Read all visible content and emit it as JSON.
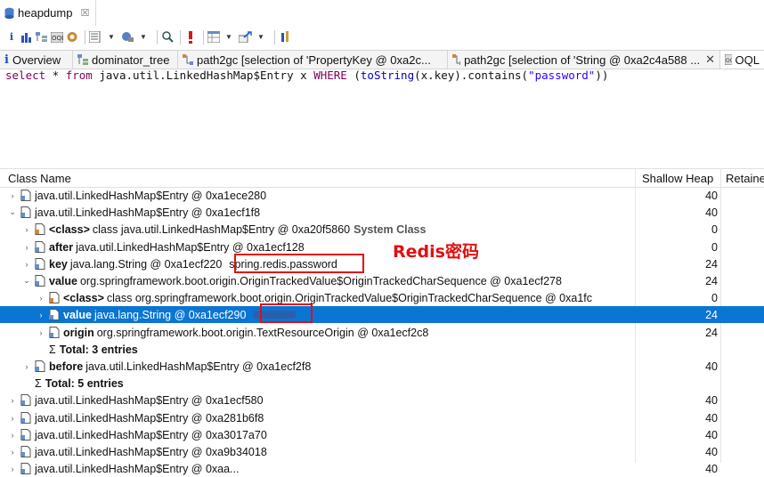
{
  "editor_tab": {
    "label": "heapdump",
    "close": "☒"
  },
  "toolbar": {
    "items": [
      "info-icon",
      "bar-chart-icon",
      "dominator-icon",
      "query-browser-icon",
      "heap-icon",
      "run-report-icon",
      "leak-icon",
      "search-icon",
      "warning-icon",
      "table-icon",
      "export-icon",
      "pin-icon"
    ]
  },
  "view_tabs": [
    {
      "icon": "i",
      "label": "Overview"
    },
    {
      "icon": "tree",
      "label": "dominator_tree"
    },
    {
      "icon": "path",
      "label": "path2gc  [selection of 'PropertyKey @ 0xa2c..."
    },
    {
      "icon": "path",
      "label": "path2gc  [selection of 'String @ 0xa2c4a588 ..."
    },
    {
      "icon": "oql",
      "label": "OQL"
    }
  ],
  "query": {
    "p1": "select",
    "p2": " * ",
    "p3": "from",
    "p4": " java.util.LinkedHashMap$Entry x ",
    "p5": "WHERE",
    "p6": " (",
    "p7": "toString",
    "p8": "(x.key).contains(",
    "p9": "\"password\"",
    "p10": "))"
  },
  "columns": {
    "name": "Class Name",
    "shallow": "Shallow Heap",
    "retained": "Retaine"
  },
  "rows": [
    {
      "indent": 0,
      "toggle": "›",
      "bold": "",
      "text": "java.util.LinkedHashMap$Entry @ 0xa1ece280",
      "shallow": "40"
    },
    {
      "indent": 0,
      "toggle": "⌄",
      "bold": "",
      "text": "java.util.LinkedHashMap$Entry @ 0xa1ecf1f8",
      "shallow": "40"
    },
    {
      "indent": 1,
      "toggle": "›",
      "bold": "<class>",
      "text": "class java.util.LinkedHashMap$Entry @ 0xa20f5860",
      "extra": "System Class",
      "shallow": "0"
    },
    {
      "indent": 1,
      "toggle": "›",
      "bold": "after",
      "text": "java.util.LinkedHashMap$Entry @ 0xa1ecf128",
      "shallow": "0"
    },
    {
      "indent": 1,
      "toggle": "›",
      "bold": "key",
      "text": "java.lang.String @ 0xa1ecf220",
      "value": "spring.redis.password",
      "shallow": "24"
    },
    {
      "indent": 1,
      "toggle": "⌄",
      "bold": "value",
      "text": "org.springframework.boot.origin.OriginTrackedValue$OriginTrackedCharSequence @ 0xa1ecf278",
      "shallow": "24"
    },
    {
      "indent": 2,
      "toggle": "›",
      "bold": "<class>",
      "text": "class org.springframework.boot.origin.OriginTrackedValue$OriginTrackedCharSequence @ 0xa1fc",
      "shallow": "0"
    },
    {
      "indent": 2,
      "toggle": "›",
      "bold": "value",
      "text": "java.lang.String @ 0xa1ecf290",
      "redacted": true,
      "shallow": "24",
      "selected": true
    },
    {
      "indent": 2,
      "toggle": "›",
      "bold": "origin",
      "text": "org.springframework.boot.origin.TextResourceOrigin @ 0xa1ecf2c8",
      "shallow": "24"
    },
    {
      "indent": 2,
      "toggle": "",
      "bold": "Total: 3 entries",
      "text": "",
      "sigma": true,
      "shallow": ""
    },
    {
      "indent": 1,
      "toggle": "›",
      "bold": "before",
      "text": "java.util.LinkedHashMap$Entry @ 0xa1ecf2f8",
      "shallow": "40"
    },
    {
      "indent": 1,
      "toggle": "",
      "bold": "Total: 5 entries",
      "text": "",
      "sigma": true,
      "shallow": ""
    },
    {
      "indent": 0,
      "toggle": "›",
      "bold": "",
      "text": "java.util.LinkedHashMap$Entry @ 0xa1ecf580",
      "shallow": "40"
    },
    {
      "indent": 0,
      "toggle": "›",
      "bold": "",
      "text": "java.util.LinkedHashMap$Entry @ 0xa281b6f8",
      "shallow": "40"
    },
    {
      "indent": 0,
      "toggle": "›",
      "bold": "",
      "text": "java.util.LinkedHashMap$Entry @ 0xa3017a70",
      "shallow": "40"
    },
    {
      "indent": 0,
      "toggle": "›",
      "bold": "",
      "text": "java.util.LinkedHashMap$Entry @ 0xa9b34018",
      "shallow": "40"
    },
    {
      "indent": 0,
      "toggle": "›",
      "bold": "",
      "text": "java.util.LinkedHashMap$Entry @ 0xaa...",
      "shallow": "40"
    }
  ],
  "annotation": "Redis密码",
  "colors": {
    "selection": "#0a75d2",
    "highlight": "#e01010",
    "keyword": "#7f0055"
  }
}
